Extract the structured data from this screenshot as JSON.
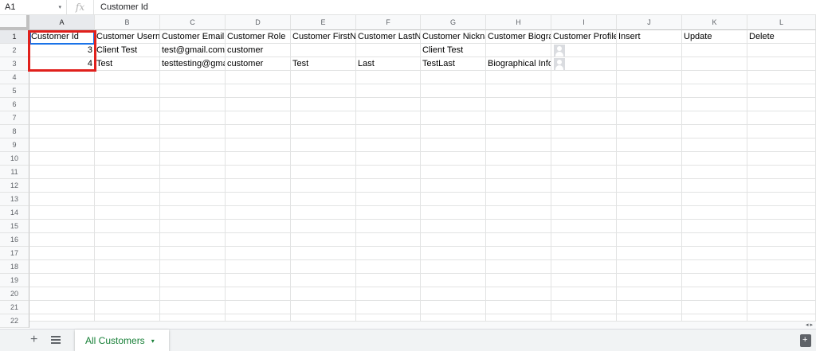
{
  "formula_bar": {
    "name_box": "A1",
    "name_box_arrow": "▾",
    "fx_label": "fx",
    "value": "Customer Id"
  },
  "columns": [
    "A",
    "B",
    "C",
    "D",
    "E",
    "F",
    "G",
    "H",
    "I",
    "J",
    "K",
    "L"
  ],
  "rows": [
    "1",
    "2",
    "3",
    "4",
    "5",
    "6",
    "7",
    "8",
    "9",
    "10",
    "11",
    "12",
    "13",
    "14",
    "15",
    "16",
    "17",
    "18",
    "19",
    "20",
    "21",
    "22"
  ],
  "cells": {
    "r1": [
      "Customer Id",
      "Customer Usern",
      "Customer Emaill",
      "Customer Role",
      "Customer FirstN",
      "Customer LastN",
      "Customer Nickna",
      "Customer Biogra",
      "Customer Profile",
      "Insert",
      "Update",
      "Delete"
    ],
    "r2": [
      "3",
      "Client Test",
      "test@gmail.com",
      "customer",
      "",
      "",
      "Client Test",
      "",
      "",
      "",
      "",
      ""
    ],
    "r3": [
      "4",
      "Test",
      "testtesting@gma",
      "customer",
      "Test",
      "Last",
      "TestLast",
      "Biographical Info",
      "",
      "",
      "",
      ""
    ]
  },
  "icons": {
    "profile_image": "avatar-icon",
    "add_sheet": "plus-icon",
    "all_sheets": "list-icon",
    "tab_menu": "triangle-down-icon",
    "explore": "explore-icon"
  },
  "sheet_tabs": [
    {
      "label": "All Customers",
      "active": true
    }
  ],
  "bottom_bar": {
    "add_label": "+",
    "tab_arrow": "▾"
  },
  "colors": {
    "selection_highlight": "#e0201c",
    "active_cell_border": "#1a73e8",
    "active_tab_text": "#188038"
  }
}
